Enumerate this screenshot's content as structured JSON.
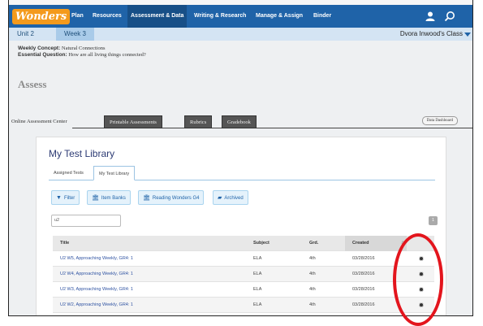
{
  "header": {
    "logo": "Wonders",
    "nav": [
      "Plan",
      "Resources",
      "Assessment & Data",
      "Writing & Research",
      "Manage & Assign",
      "Binder"
    ],
    "active_nav": "Assessment & Data",
    "user_icon": "user-icon",
    "search_icon": "search-icon"
  },
  "unit_bar": {
    "unit": "Unit 2",
    "week": "Week 3",
    "class_name": "Dvora Inwood's Class"
  },
  "concept": {
    "weekly_concept_label": "Weekly Concept:",
    "weekly_concept": "Natural Connections",
    "essential_question_label": "Essential Question:",
    "essential_question": "How are all living things connected?",
    "section_title": "Assess"
  },
  "main_tabs": {
    "tab1": "Online Assessment Center",
    "tab2": "Printable Assessments",
    "tab3": "Rubrics",
    "tab4": "Gradebook",
    "data_dashboard": "Data Dashboard"
  },
  "library": {
    "title": "My Test Library",
    "subtabs": [
      "Assigned Tests",
      "My Test Library"
    ],
    "active_subtab": "My Test Library",
    "filters": [
      "Filter",
      "Item Banks",
      "Reading Wonders G4",
      "Archived"
    ],
    "search_value": "u2",
    "page_number": "1"
  },
  "table": {
    "headers": {
      "title": "Title",
      "subject": "Subject",
      "grade": "Grd.",
      "created": "Created",
      "sort": "⇵"
    },
    "rows": [
      {
        "title": "U2 W5, Approaching Weekly, GR4: 1",
        "subject": "ELA",
        "grade": "4th",
        "created": "03/28/2016"
      },
      {
        "title": "U2 W4, Approaching Weekly, GR4: 1",
        "subject": "ELA",
        "grade": "4th",
        "created": "03/28/2016"
      },
      {
        "title": "U2 W3, Approaching Weekly, GR4: 1",
        "subject": "ELA",
        "grade": "4th",
        "created": "03/28/2016"
      },
      {
        "title": "U2 W2, Approaching Weekly, GR4: 1",
        "subject": "ELA",
        "grade": "4th",
        "created": "03/28/2016"
      }
    ],
    "row_action_icon": "gear-icon"
  },
  "colors": {
    "nav_bg": "#1f63a8",
    "logo_bg": "#f49a1c",
    "unit_bar_bg": "#d4e4f3",
    "link": "#2f53a2",
    "annotation": "#e3151d"
  }
}
